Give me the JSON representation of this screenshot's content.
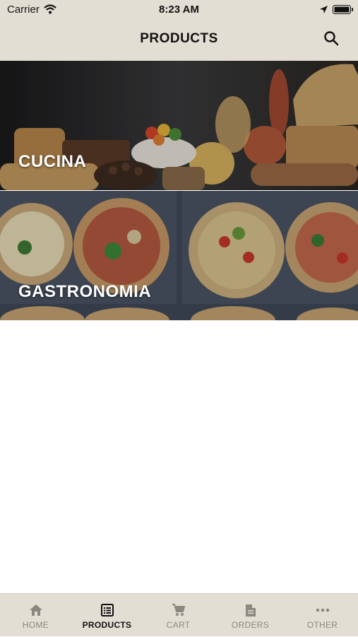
{
  "status_bar": {
    "carrier": "Carrier",
    "time": "8:23 AM"
  },
  "header": {
    "title": "PRODUCTS"
  },
  "categories": [
    {
      "label": "CUCINA"
    },
    {
      "label": "GASTRONOMIA"
    }
  ],
  "tabs": [
    {
      "label": "HOME",
      "icon": "home-icon",
      "active": false
    },
    {
      "label": "PRODUCTS",
      "icon": "list-icon",
      "active": true
    },
    {
      "label": "CART",
      "icon": "cart-icon",
      "active": false
    },
    {
      "label": "ORDERS",
      "icon": "document-icon",
      "active": false
    },
    {
      "label": "OTHER",
      "icon": "more-icon",
      "active": false
    }
  ],
  "colors": {
    "bar_background": "#e2ded3",
    "active_tab": "#111111",
    "inactive_tab": "#8b8880"
  }
}
